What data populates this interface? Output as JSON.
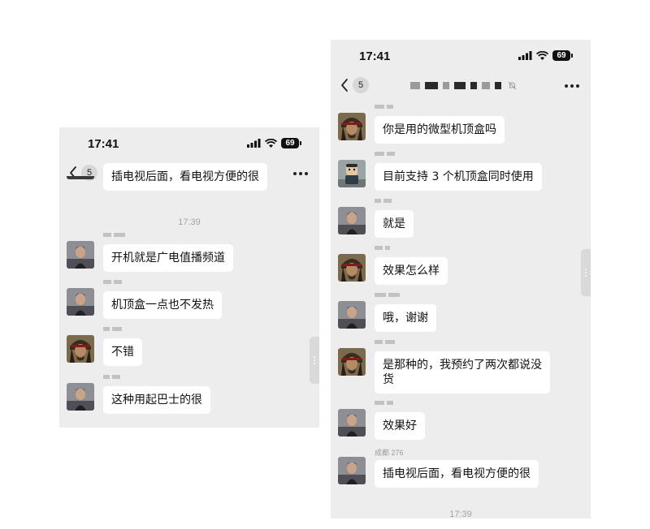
{
  "left": {
    "status": {
      "time": "17:41",
      "battery": "69"
    },
    "nav": {
      "unread": "5"
    },
    "partial_message": "插电视后面，看电视方便的很",
    "time_separator": "17:39",
    "messages": [
      {
        "avatar": "man-portrait",
        "text": "开机就是广电值播频道"
      },
      {
        "avatar": "man-portrait",
        "text": "机顶盒一点也不发热"
      },
      {
        "avatar": "pirate-portrait",
        "text": "不错"
      },
      {
        "avatar": "man-portrait",
        "text": "这种用起巴士的很"
      }
    ]
  },
  "right": {
    "status": {
      "time": "17:41",
      "battery": "69"
    },
    "nav": {
      "unread": "5"
    },
    "messages": [
      {
        "avatar": "pirate-portrait",
        "sender": "",
        "text": "你是用的微型机顶盒吗"
      },
      {
        "avatar": "figurine-portrait",
        "sender": "",
        "text": "目前支持 3 个机顶盒同时使用"
      },
      {
        "avatar": "man-portrait",
        "sender": "",
        "text": "就是"
      },
      {
        "avatar": "pirate-portrait",
        "sender": "",
        "text": "效果怎么样"
      },
      {
        "avatar": "man-portrait",
        "sender": "",
        "text": "哦，谢谢"
      },
      {
        "avatar": "pirate-portrait",
        "sender": "",
        "text": "是那种的，我预约了两次都说没货"
      },
      {
        "avatar": "man-portrait",
        "sender": "",
        "text": "效果好"
      },
      {
        "avatar": "man-portrait",
        "sender": "成都 276",
        "text": "插电视后面，看电视方便的很"
      }
    ],
    "time_separator": "17:39"
  }
}
